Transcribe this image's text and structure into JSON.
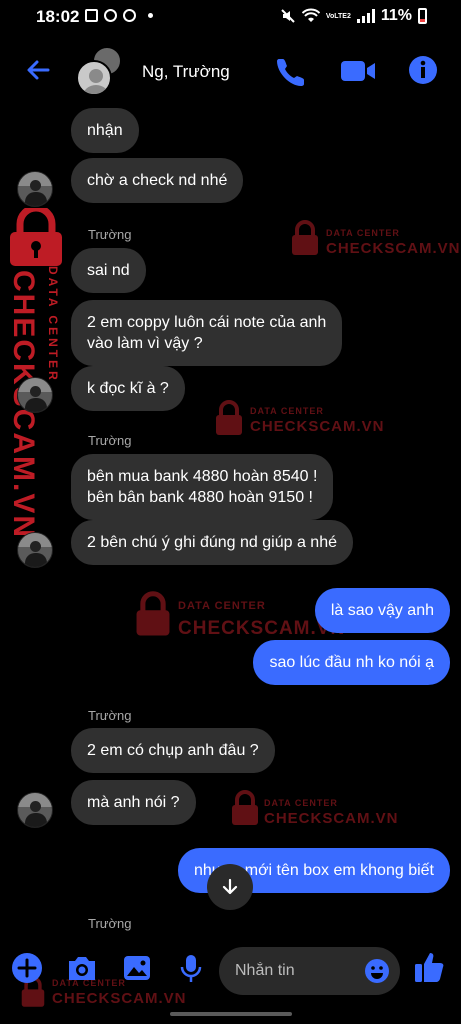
{
  "status_bar": {
    "time": "18:02",
    "network_label": "VoLTE2",
    "battery": "11%"
  },
  "header": {
    "title": "Ng, Trường",
    "back_icon": "back-arrow-icon",
    "call_icon": "phone-icon",
    "video_icon": "video-camera-icon",
    "info_icon": "info-icon"
  },
  "messages": {
    "m1": "nhận",
    "m2": "chờ a check nd nhé",
    "sender1": "Trường",
    "m3": "sai nd",
    "m4": "2 em coppy luôn cái note của anh\nvào làm vì vậy ?",
    "m5": "k đọc kĩ à ?",
    "sender2": "Trường",
    "m6": "bên mua bank 4880  hoàn 8540 !\nbên bân bank 4880 hoàn 9150 !",
    "m7": "2 bên chú ý ghi đúng nd giúp a nhé",
    "out1": "là sao vậy anh",
    "out2": "sao lúc đầu nh ko nói ạ",
    "sender3": "Trường",
    "m8": "2 em có chụp anh đâu ?",
    "m9": "mà anh nói ?",
    "out3": "nhưng mới tên box em khong biết",
    "sender4": "Trường"
  },
  "watermark": {
    "small": "DATA CENTER",
    "big": "CHECKSCAM.VN"
  },
  "composer": {
    "placeholder": "Nhắn tin"
  },
  "colors": {
    "accent": "#3a6bff",
    "incoming_bubble": "#303030",
    "watermark": "#d4242e"
  }
}
